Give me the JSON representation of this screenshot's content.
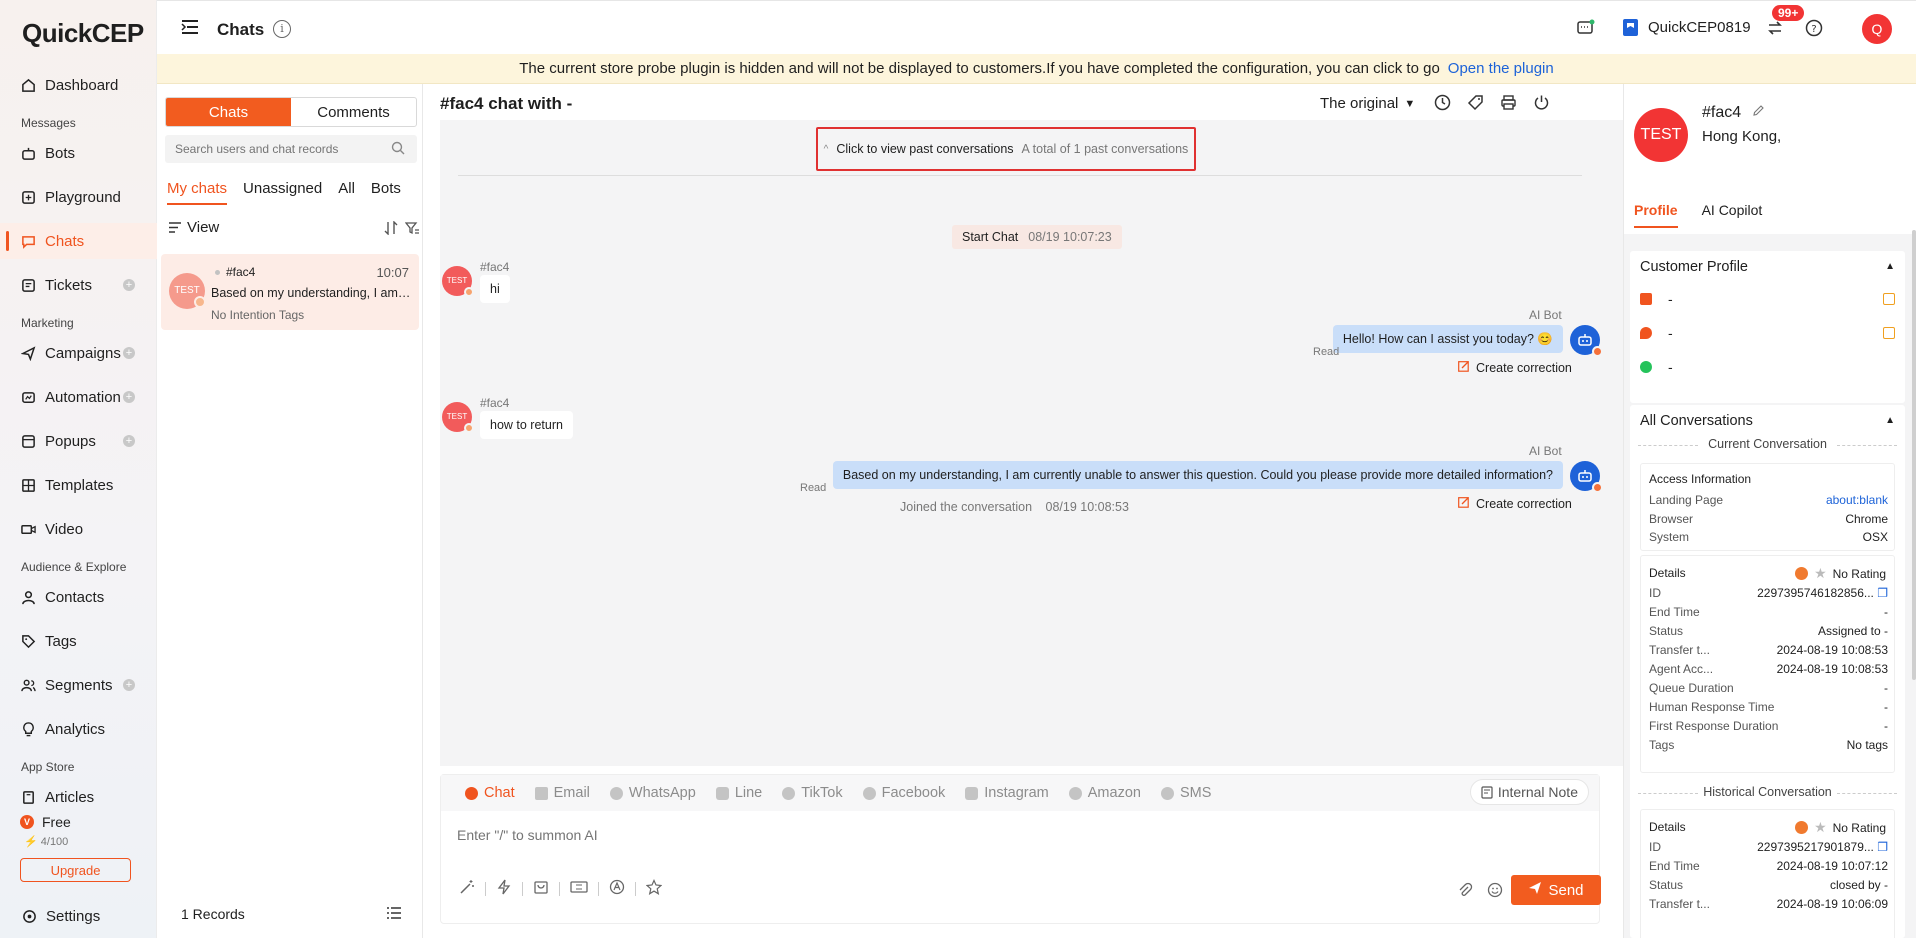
{
  "app": {
    "logo": "QuickCEP",
    "page_title": "Chats",
    "store_name": "QuickCEP0819",
    "notif_badge": "99+",
    "user_initial": "Q"
  },
  "sidebar": {
    "items": [
      {
        "label": "Dashboard"
      },
      {
        "section": "Messages"
      },
      {
        "label": "Bots"
      },
      {
        "label": "Playground"
      },
      {
        "label": "Chats"
      },
      {
        "label": "Tickets"
      },
      {
        "section": "Marketing"
      },
      {
        "label": "Campaigns"
      },
      {
        "label": "Automation"
      },
      {
        "label": "Popups"
      },
      {
        "label": "Templates"
      },
      {
        "label": "Video"
      },
      {
        "section": "Audience & Explore"
      },
      {
        "label": "Contacts"
      },
      {
        "label": "Tags"
      },
      {
        "label": "Segments"
      },
      {
        "label": "Analytics"
      },
      {
        "section": "App Store"
      },
      {
        "label": "Articles"
      }
    ],
    "plan": "Free",
    "quota": "4/100",
    "upgrade_label": "Upgrade",
    "settings_label": "Settings"
  },
  "banner": {
    "text": "The current store probe plugin is hidden and will not be displayed to customers.If you have completed the configuration, you can click to go",
    "link": "Open the plugin"
  },
  "chat_list": {
    "seg_chats": "Chats",
    "seg_comments": "Comments",
    "search_placeholder": "Search users and chat records",
    "tabs": [
      "My chats",
      "Unassigned",
      "All",
      "Bots"
    ],
    "view_label": "View",
    "conversation": {
      "avatar": "TEST",
      "name": "#fac4",
      "time": "10:07",
      "preview": "Based on my understanding, I am currently unable to answer this question.",
      "tags": "No Intention Tags"
    },
    "records": "1 Records"
  },
  "chat": {
    "title": "#fac4 chat with -",
    "original_label": "The original",
    "past_label": "Click to view past conversations",
    "past_count": "A total of 1 past conversations",
    "start_label": "Start Chat",
    "start_time": "08/19 10:07:23",
    "customer_name": "#fac4",
    "customer_avatar": "TEST",
    "bot_name": "AI Bot",
    "read_label": "Read",
    "correction_label": "Create correction",
    "messages": [
      {
        "text": "hi"
      },
      {
        "text": "Hello! How can I assist you today? 😊"
      },
      {
        "text": "how to return"
      },
      {
        "text": "Based on my understanding, I am currently unable to answer this question. Could you please provide more detailed information?"
      }
    ],
    "joined_label": "Joined the conversation",
    "joined_time": "08/19 10:08:53"
  },
  "composer": {
    "channels": [
      "Chat",
      "Email",
      "WhatsApp",
      "Line",
      "TikTok",
      "Facebook",
      "Instagram",
      "Amazon",
      "SMS"
    ],
    "internal_note": "Internal Note",
    "placeholder": "Enter \"/\" to summon AI",
    "send_label": "Send"
  },
  "profile": {
    "avatar": "TEST",
    "name": "#fac4",
    "location": "Hong Kong,",
    "tabs": [
      "Profile",
      "AI Copilot"
    ],
    "customer_profile_title": "Customer Profile",
    "email": "-",
    "phone": "-",
    "whatsapp": "-",
    "all_conversations_title": "All Conversations",
    "current_heading": "Current Conversation",
    "access_title": "Access Information",
    "access": [
      {
        "k": "Landing Page",
        "v": "about:blank"
      },
      {
        "k": "Browser",
        "v": "Chrome"
      },
      {
        "k": "System",
        "v": "OSX"
      }
    ],
    "details_title": "Details",
    "no_rating": "No Rating",
    "details": [
      {
        "k": "ID",
        "v": "2297395746182856..."
      },
      {
        "k": "End Time",
        "v": "-"
      },
      {
        "k": "Status",
        "v": "Assigned to -"
      },
      {
        "k": "Transfer t...",
        "v": "2024-08-19 10:08:53"
      },
      {
        "k": "Agent Acc...",
        "v": "2024-08-19 10:08:53"
      },
      {
        "k": "Queue Duration",
        "v": "-"
      },
      {
        "k": "Human Response Time",
        "v": "-"
      },
      {
        "k": "First Response Duration",
        "v": "-"
      },
      {
        "k": "Tags",
        "v": "No tags"
      }
    ],
    "historical_heading": "Historical Conversation",
    "hist_details": [
      {
        "k": "ID",
        "v": "2297395217901879..."
      },
      {
        "k": "End Time",
        "v": "2024-08-19 10:07:12"
      },
      {
        "k": "Status",
        "v": "closed by -"
      },
      {
        "k": "Transfer t...",
        "v": "2024-08-19 10:06:09"
      }
    ]
  }
}
